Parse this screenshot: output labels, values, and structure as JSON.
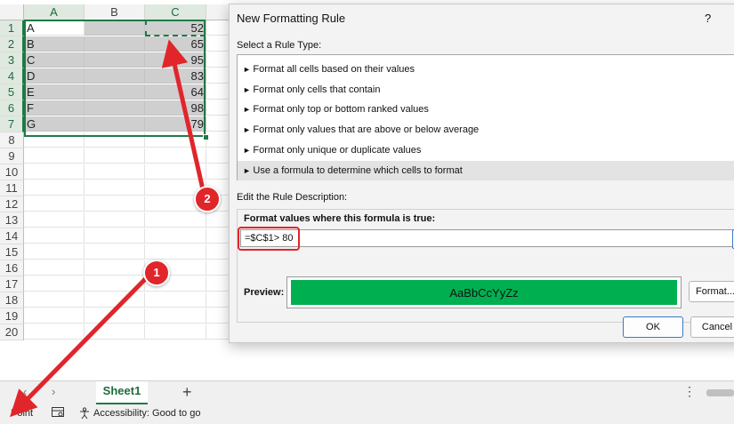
{
  "spreadsheet": {
    "column_headers": [
      "A",
      "B",
      "C"
    ],
    "row_numbers": [
      "1",
      "2",
      "3",
      "4",
      "5",
      "6",
      "7",
      "8",
      "9",
      "10",
      "11",
      "12",
      "13",
      "14",
      "15",
      "16",
      "17",
      "18",
      "19",
      "20"
    ],
    "rows": [
      {
        "a": "A",
        "c": "52"
      },
      {
        "a": "B",
        "c": "65"
      },
      {
        "a": "C",
        "c": "95"
      },
      {
        "a": "D",
        "c": "83"
      },
      {
        "a": "E",
        "c": "64"
      },
      {
        "a": "F",
        "c": "98"
      },
      {
        "a": "G",
        "c": "79"
      }
    ]
  },
  "dialog": {
    "title": "New Formatting Rule",
    "help": "?",
    "rule_type_label": "Select a Rule Type:",
    "rule_types": [
      "Format all cells based on their values",
      "Format only cells that contain",
      "Format only top or bottom ranked values",
      "Format only values that are above or below average",
      "Format only unique or duplicate values",
      "Use a formula to determine which cells to format"
    ],
    "selected_rule_index": 5,
    "edit_description_label": "Edit the Rule Description:",
    "formula_label": "Format values where this formula is true:",
    "formula_value": "=$C$1> 80",
    "preview_label": "Preview:",
    "preview_sample": "AaBbCcYyZz",
    "preview_fill_color": "#00B050",
    "format_button": "Format...",
    "ok_button": "OK",
    "cancel_button": "Cancel"
  },
  "sheet_tabs": {
    "nav_prev": "‹",
    "nav_next": "›",
    "active_sheet": "Sheet1",
    "add_sheet": "+",
    "more_options": "⋮"
  },
  "status_bar": {
    "mode": "Point",
    "accessibility": "Accessibility: Good to go"
  },
  "annotations": {
    "callout_1": "1",
    "callout_2": "2",
    "arrow_color": "#E0262B"
  }
}
